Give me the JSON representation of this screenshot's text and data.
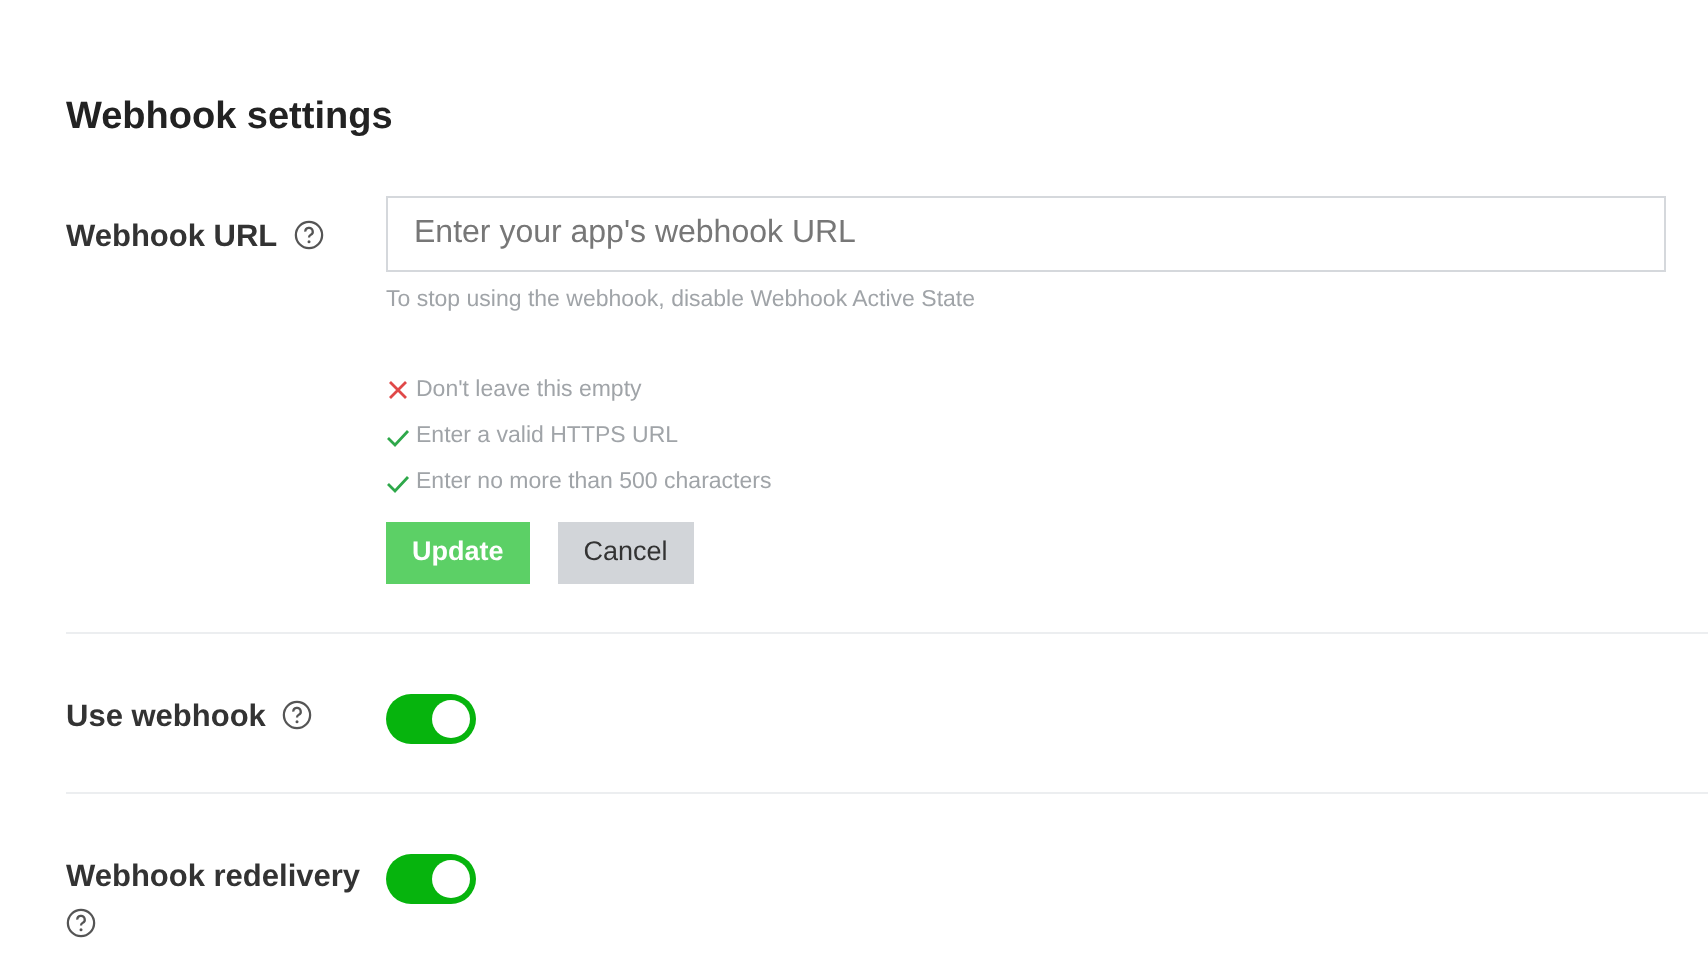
{
  "title": "Webhook settings",
  "webhook_url": {
    "label": "Webhook URL",
    "placeholder": "Enter your app's webhook URL",
    "hint": "To stop using the webhook, disable Webhook Active State",
    "rules": [
      {
        "text": "Don't leave this empty",
        "passed": false
      },
      {
        "text": "Enter a valid HTTPS URL",
        "passed": true
      },
      {
        "text": "Enter no more than 500 characters",
        "passed": true
      }
    ],
    "buttons": [
      {
        "kind": "primary",
        "label": "Update"
      },
      {
        "kind": "secondary",
        "label": "Cancel"
      }
    ]
  },
  "toggles": [
    {
      "label": "Use webhook",
      "on": true
    },
    {
      "label": "Webhook redelivery",
      "on": true
    }
  ]
}
